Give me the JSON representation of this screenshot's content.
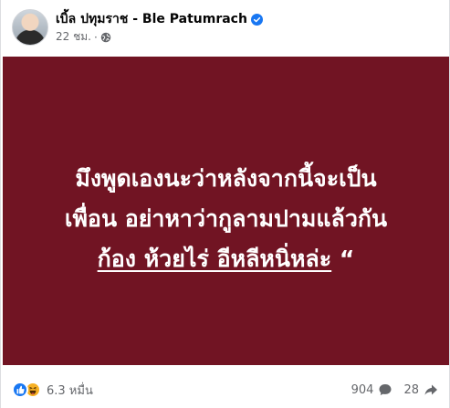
{
  "author": {
    "name": "เบิ้ล ปทุมราช - Ble Patumrach",
    "verified": true
  },
  "post": {
    "time": "22 ชม.",
    "separator": "·",
    "audience_icon": "globe-icon",
    "background_color": "#711423",
    "text_lines": [
      "มึงพูดเองนะว่าหลังจากนี้จะเป็น",
      "เพื่อน อย่าหาว่ากูลามปามแล้วกัน"
    ],
    "last_line_underlined": "ก้อง ห้วยไร่ อีหลีหนิ่หล่ะ",
    "last_line_tail": "“"
  },
  "footer": {
    "reaction_icons": [
      "like-icon",
      "haha-icon"
    ],
    "reaction_count": "6.3 หมื่น",
    "comments_count": "904",
    "shares_count": "28"
  }
}
